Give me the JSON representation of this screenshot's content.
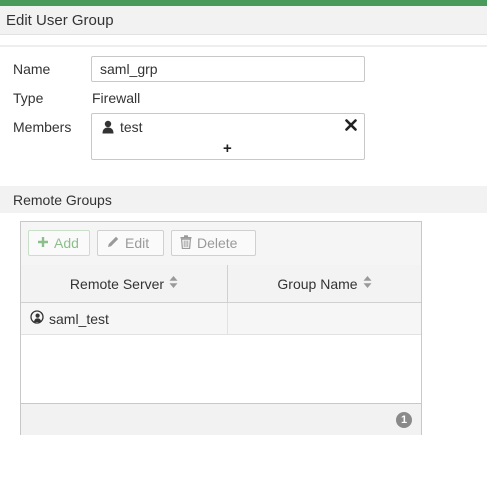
{
  "header": {
    "title": "Edit User Group"
  },
  "form": {
    "name_label": "Name",
    "name_value": "saml_grp",
    "type_label": "Type",
    "type_value": "Firewall",
    "members_label": "Members",
    "members": [
      {
        "name": "test",
        "icon": "user-icon"
      }
    ],
    "add_member_symbol": "+"
  },
  "remote_groups": {
    "title": "Remote Groups",
    "toolbar": {
      "add_label": "Add",
      "edit_label": "Edit",
      "delete_label": "Delete"
    },
    "columns": [
      "Remote Server",
      "Group Name"
    ],
    "rows": [
      {
        "remote_server": "saml_test",
        "group_name": "",
        "icon": "saml-server-icon"
      }
    ],
    "count": "1"
  },
  "colors": {
    "accent": "#4a9a5b",
    "add_green": "#8cbf8c"
  }
}
